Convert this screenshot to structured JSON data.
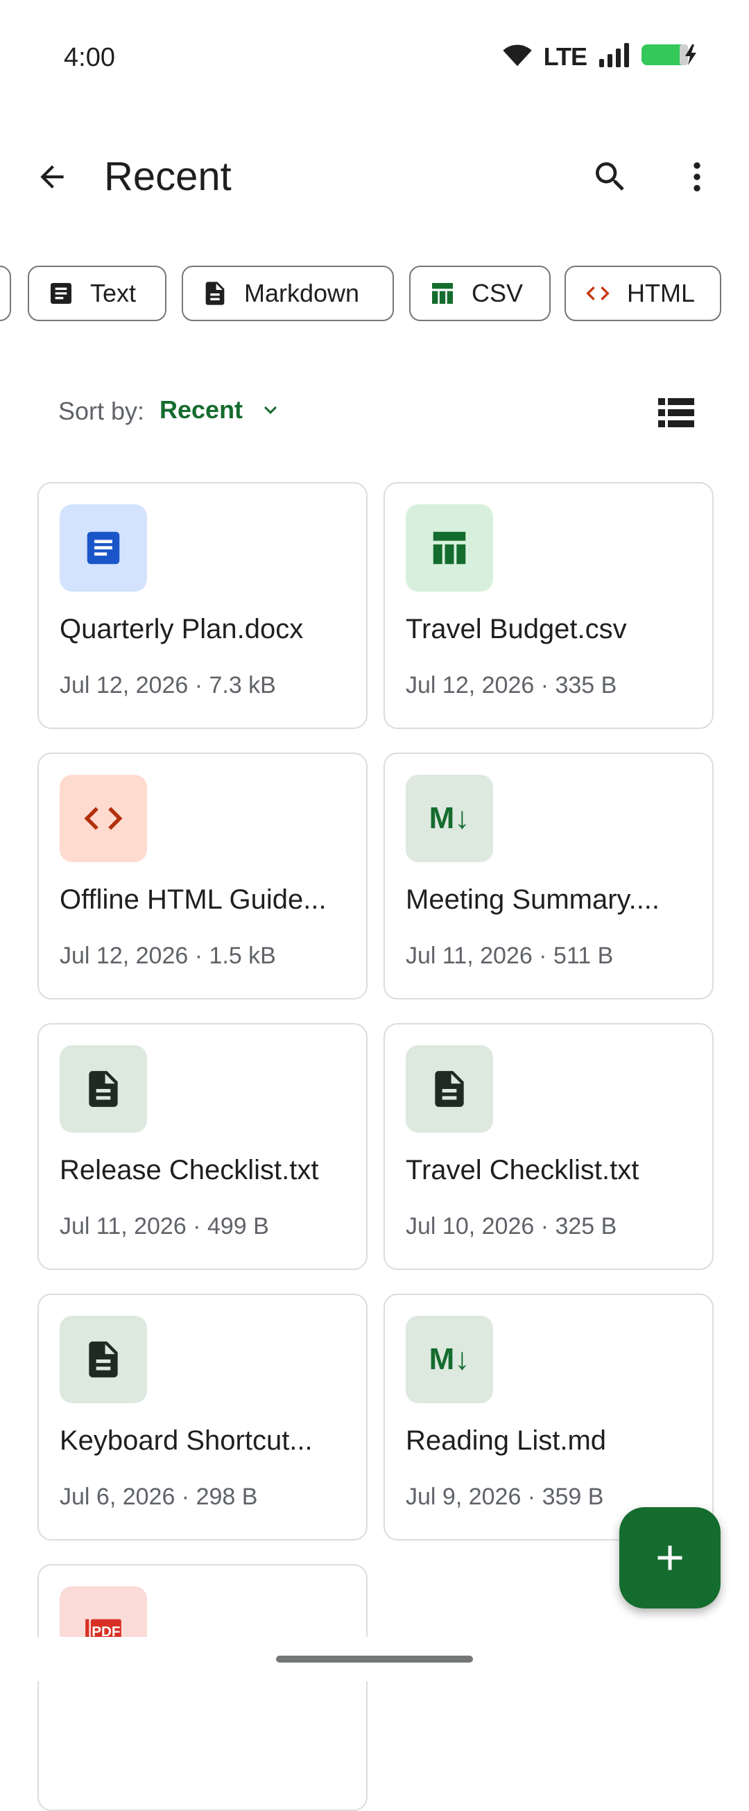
{
  "status": {
    "time": "4:00",
    "network": "LTE"
  },
  "app_bar": {
    "title": "Recent"
  },
  "chips": [
    {
      "label": "Text",
      "icon": "text-doc-icon"
    },
    {
      "label": "Markdown",
      "icon": "markdown-doc-icon"
    },
    {
      "label": "CSV",
      "icon": "table-icon"
    },
    {
      "label": "HTML",
      "icon": "code-icon"
    }
  ],
  "sort": {
    "label": "Sort by:",
    "value": "Recent"
  },
  "files": [
    {
      "name": "Quarterly Plan.docx",
      "meta": "Jul 12, 2026 · 7.3 kB",
      "type": "docx"
    },
    {
      "name": "Travel Budget.csv",
      "meta": "Jul 12, 2026 · 335 B",
      "type": "csv"
    },
    {
      "name": "Offline HTML Guide...",
      "meta": "Jul 12, 2026 · 1.5 kB",
      "type": "html"
    },
    {
      "name": "Meeting Summary....",
      "meta": "Jul 11, 2026 · 511 B",
      "type": "md"
    },
    {
      "name": "Release Checklist.txt",
      "meta": "Jul 11, 2026 · 499 B",
      "type": "txt"
    },
    {
      "name": "Travel Checklist.txt",
      "meta": "Jul 10, 2026 · 325 B",
      "type": "txt"
    },
    {
      "name": "Keyboard Shortcut...",
      "meta": "Jul 6, 2026 · 298 B",
      "type": "txt"
    },
    {
      "name": "Reading List.md",
      "meta": "Jul 9, 2026 · 359 B",
      "type": "md"
    },
    {
      "name": "",
      "meta": "",
      "type": "pdf"
    }
  ],
  "md_glyph": "M↓",
  "pdf_glyph": "PDF",
  "colors": {
    "accent": "#146c2e",
    "docx_bg": "#d3e3fd",
    "csv_bg": "#d7f0dd",
    "html_bg": "#ffdbcf",
    "generic_bg": "#dde8df",
    "pdf_bg": "#fadbd8"
  }
}
